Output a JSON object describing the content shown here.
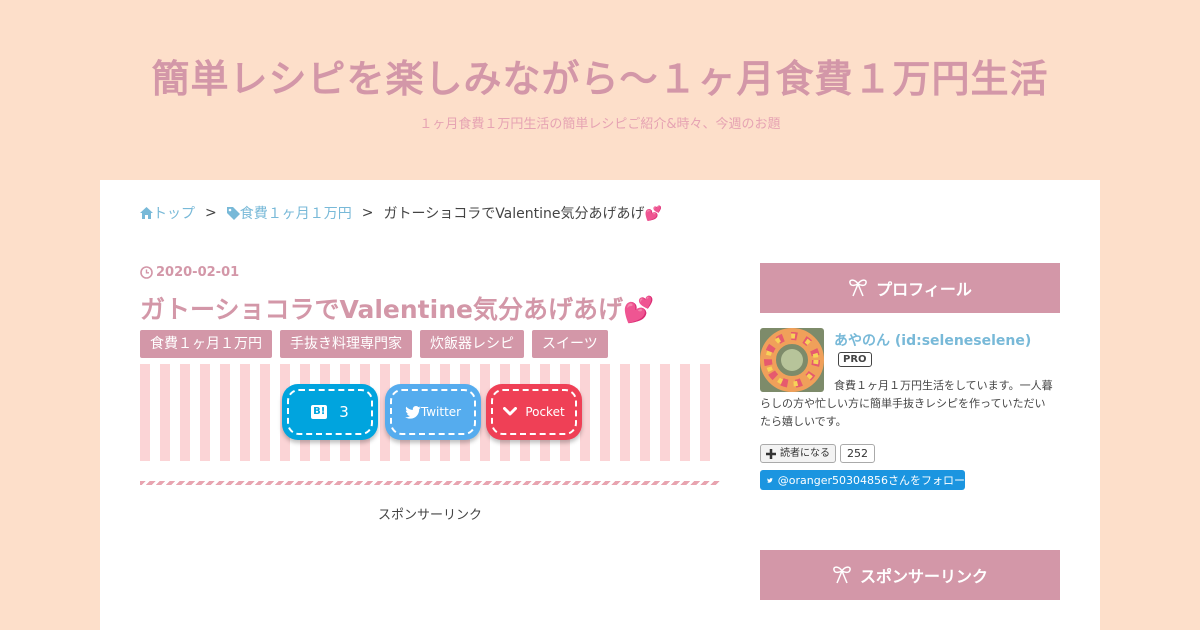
{
  "site": {
    "title": "簡単レシピを楽しみながら〜１ヶ月食費１万円生活",
    "description": "１ヶ月食費１万円生活の簡単レシピご紹介&時々、今週のお題"
  },
  "breadcrumb": {
    "home": "トップ",
    "category": "食費１ヶ月１万円",
    "current": "ガトーショコラでValentine気分あげあげ💕",
    "separator": ">"
  },
  "entry": {
    "date": "2020-02-01",
    "title": "ガトーショコラでValentine気分あげあげ💕",
    "categories": [
      "食費１ヶ月１万円",
      "手抜き料理専門家",
      "炊飯器レシピ",
      "スイーツ"
    ]
  },
  "share": {
    "hatena_logo": "B!",
    "hatena_count": "3",
    "twitter_label": "Twitter",
    "pocket_label": "Pocket"
  },
  "sponsor_label": "スポンサーリンク",
  "sidebar": {
    "profile_heading": "プロフィール",
    "profile_name": "あやのん (id:seleneselene)",
    "pro_badge": "PRO",
    "profile_desc": "食費１ヶ月１万円生活をしています。一人暮らしの方や忙しい方に簡単手抜きレシピを作っていただいたら嬉しいです。",
    "reader_button": "読者になる",
    "reader_count": "252",
    "follow_button": "@oranger50304856さんをフォロー",
    "sponsor_heading": "スポンサーリンク"
  },
  "colors": {
    "background": "#fddfca",
    "accent": "#d397a8",
    "link": "#78b9d8",
    "hatena": "#00a4de",
    "twitter": "#55acee",
    "pocket": "#ef4056"
  }
}
